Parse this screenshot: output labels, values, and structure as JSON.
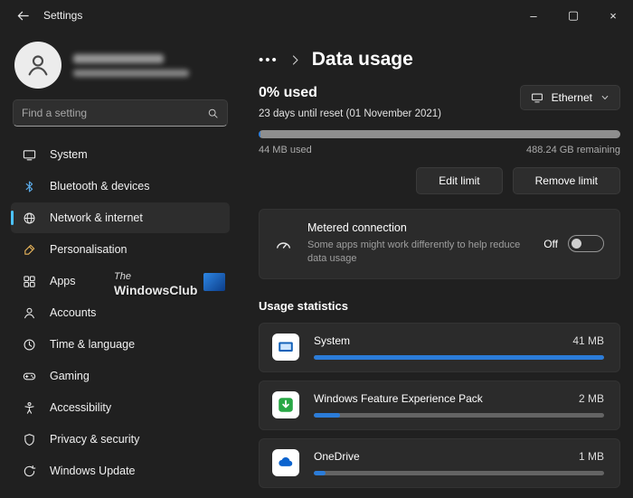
{
  "colors": {
    "accent": "#4cc2ff",
    "progress": "#2b7cd9",
    "card": "#2b2b2b",
    "background": "#202020"
  },
  "titlebar": {
    "title": "Settings",
    "controls": {
      "minimize": "–",
      "maximize": "▢",
      "close": "×"
    }
  },
  "sidebar": {
    "search_placeholder": "Find a setting",
    "items": [
      {
        "label": "System",
        "icon": "system-icon",
        "selected": false
      },
      {
        "label": "Bluetooth & devices",
        "icon": "bluetooth-icon",
        "selected": false
      },
      {
        "label": "Network & internet",
        "icon": "network-icon",
        "selected": true
      },
      {
        "label": "Personalisation",
        "icon": "personalisation-icon",
        "selected": false
      },
      {
        "label": "Apps",
        "icon": "apps-icon",
        "selected": false
      },
      {
        "label": "Accounts",
        "icon": "accounts-icon",
        "selected": false
      },
      {
        "label": "Time & language",
        "icon": "time-language-icon",
        "selected": false
      },
      {
        "label": "Gaming",
        "icon": "gaming-icon",
        "selected": false
      },
      {
        "label": "Accessibility",
        "icon": "accessibility-icon",
        "selected": false
      },
      {
        "label": "Privacy & security",
        "icon": "privacy-icon",
        "selected": false
      },
      {
        "label": "Windows Update",
        "icon": "windows-update-icon",
        "selected": false
      }
    ]
  },
  "main": {
    "breadcrumb": {
      "ellipsis": "•••",
      "title": "Data usage"
    },
    "summary": {
      "heading": "0% used",
      "reset": "23 days until reset (01 November 2021)",
      "used": "44 MB used",
      "remaining": "488.24 GB remaining",
      "progress_percent": 0.5
    },
    "connection": {
      "label": "Ethernet",
      "icon": "ethernet-icon"
    },
    "actions": {
      "edit": "Edit limit",
      "remove": "Remove limit"
    },
    "metered": {
      "title": "Metered connection",
      "description": "Some apps might work differently to help reduce data usage",
      "state_label": "Off",
      "enabled": false
    },
    "usage": {
      "header": "Usage statistics",
      "apps": [
        {
          "name": "System",
          "size": "41 MB",
          "percent": 100,
          "icon": "system-app-icon"
        },
        {
          "name": "Windows Feature Experience Pack",
          "size": "2 MB",
          "percent": 9,
          "icon": "windows-feature-pack-icon"
        },
        {
          "name": "OneDrive",
          "size": "1 MB",
          "percent": 4,
          "icon": "onedrive-icon"
        }
      ]
    }
  },
  "watermark": {
    "line1": "The",
    "line2": "WindowsClub"
  }
}
